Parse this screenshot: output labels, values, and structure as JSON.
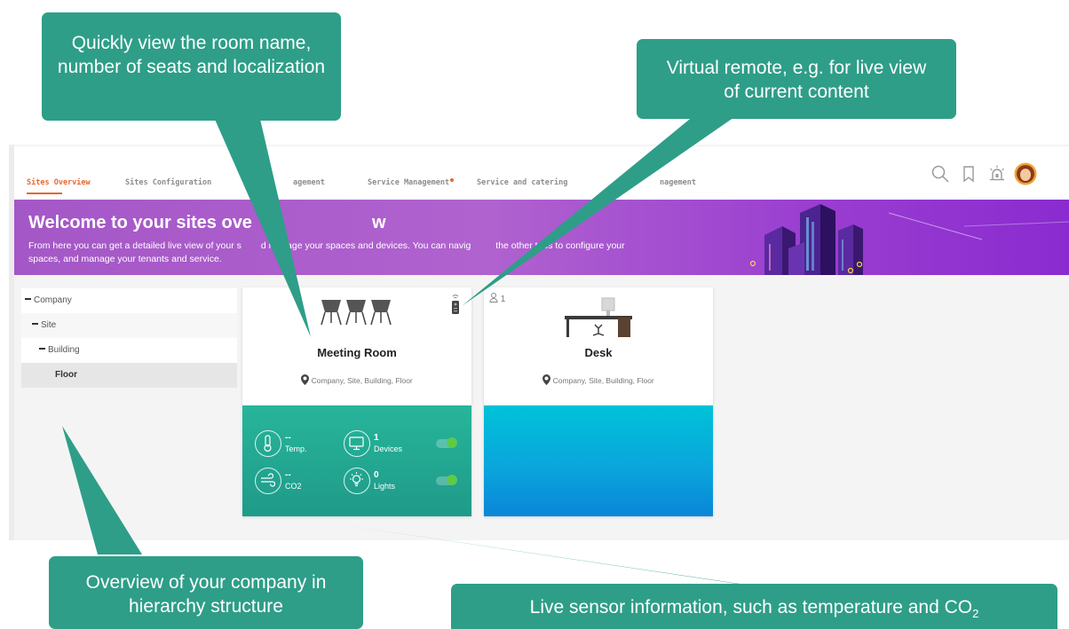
{
  "callouts": {
    "room_info": "Quickly view the room name, number of seats and localization",
    "remote": "Virtual remote, e.g. for live view of current content",
    "hierarchy": "Overview of your company in hierarchy structure",
    "sensors_main": "Live sensor information, such as temperature and CO",
    "sensors_sub": "2"
  },
  "nav": {
    "tabs": [
      {
        "label": "Sites Overview",
        "active": true
      },
      {
        "label": "Sites Configuration"
      },
      {
        "label": "agement"
      },
      {
        "label": "Service Management"
      },
      {
        "label": "Service and catering"
      },
      {
        "label": "nagement"
      }
    ],
    "icons": [
      "search-icon",
      "bookmark-icon",
      "alarm-icon",
      "avatar"
    ]
  },
  "banner": {
    "title_left": "Welcome to your sites ove",
    "title_right": "w",
    "text_line1_a": "From here you can get a detailed live view of your s",
    "text_line1_b": "d manage your spaces and devices. You can navig",
    "text_line1_c": "the other tabs to configure your",
    "text_line2": "spaces, and manage your tenants and service."
  },
  "tree": [
    {
      "label": "Company",
      "level": 0,
      "collapse": true
    },
    {
      "label": "Site",
      "level": 1,
      "collapse": true
    },
    {
      "label": "Building",
      "level": 2,
      "collapse": true
    },
    {
      "label": "Floor",
      "level": 3,
      "selected": true
    }
  ],
  "cards": [
    {
      "title": "Meeting Room",
      "location": "Company, Site, Building, Floor",
      "image": "meeting-chairs",
      "sensors": [
        {
          "value": "--",
          "label": "Temp.",
          "icon": "thermometer-icon"
        },
        {
          "value": "1",
          "label": "Devices",
          "icon": "monitor-icon",
          "toggle": true
        },
        {
          "value": "--",
          "label": "CO2",
          "icon": "wind-icon"
        },
        {
          "value": "0",
          "label": "Lights",
          "icon": "bulb-icon",
          "toggle": true
        }
      ]
    },
    {
      "title": "Desk",
      "seats": "1",
      "location": "Company, Site, Building, Floor",
      "image": "desk"
    }
  ],
  "colors": {
    "callout": "#2e9e88",
    "accent": "#e8672e",
    "banner": "#a457c6",
    "toggle_on": "#5ec94b"
  }
}
